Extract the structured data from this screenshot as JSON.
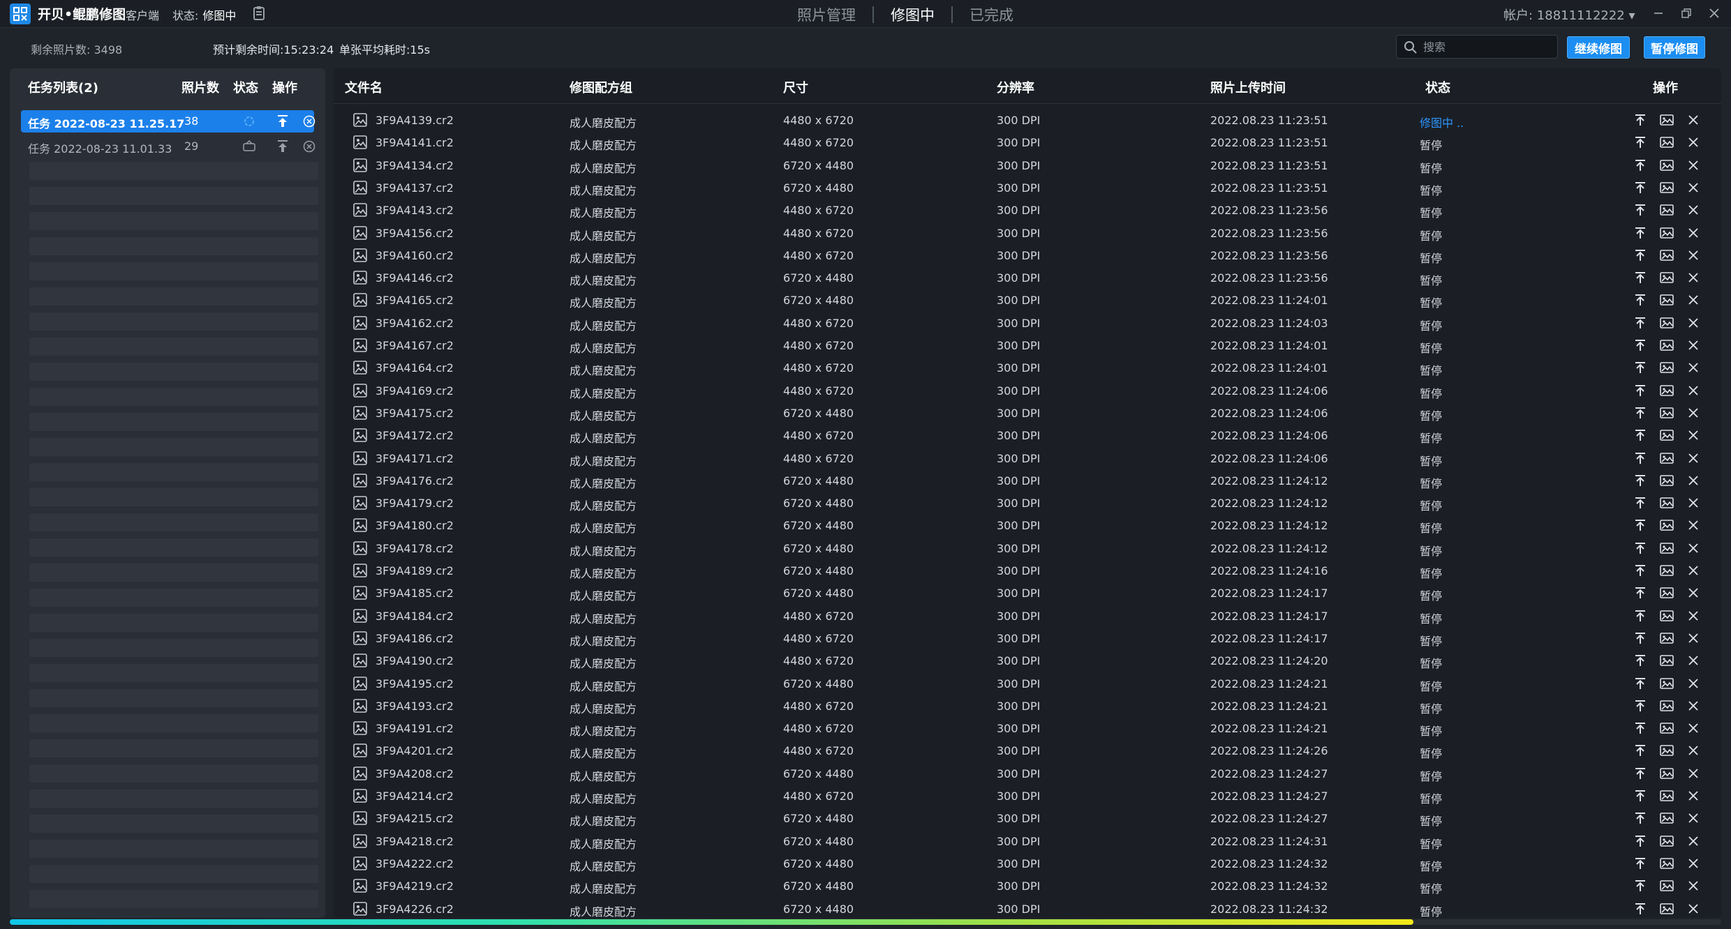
{
  "app": {
    "title": "开贝•鲲鹏修图",
    "subtitle": "客户端",
    "status_label": "状态:",
    "status_value": "修图中"
  },
  "nav": {
    "tabs": [
      {
        "label": "照片管理",
        "active": false
      },
      {
        "label": "修图中",
        "active": true
      },
      {
        "label": "已完成",
        "active": false
      }
    ]
  },
  "account": {
    "label": "帐户: 18811112222"
  },
  "info": {
    "remaining_label": "剩余照片数:",
    "remaining_value": "3498",
    "eta": "预计剩余时间:15:23:24",
    "avg": "单张平均耗时:15s"
  },
  "search": {
    "placeholder": "搜索",
    "value": ""
  },
  "buttons": {
    "resume": "继续修图",
    "pause": "暂停修图"
  },
  "task_list": {
    "header": {
      "title": "任务列表(2)",
      "count": "照片数",
      "state": "状态",
      "ops": "操作"
    },
    "tasks": [
      {
        "name": "任务 2022-08-23 11.25.17",
        "count": "38",
        "selected": true
      },
      {
        "name": "任务 2022-08-23 11.01.33",
        "count": "29",
        "selected": false
      }
    ]
  },
  "table": {
    "headers": {
      "file": "文件名",
      "recipe": "修图配方组",
      "size": "尺寸",
      "res": "分辨率",
      "time": "照片上传时间",
      "status": "状态",
      "ops": "操作"
    },
    "rows": [
      [
        "3F9A4139.cr2",
        "成人磨皮配方",
        "4480 x 6720",
        "300 DPI",
        "2022.08.23 11:23:51",
        "修图中 .."
      ],
      [
        "3F9A4141.cr2",
        "成人磨皮配方",
        "4480 x 6720",
        "300 DPI",
        "2022.08.23 11:23:51",
        "暂停"
      ],
      [
        "3F9A4134.cr2",
        "成人磨皮配方",
        "6720 x 4480",
        "300 DPI",
        "2022.08.23 11:23:51",
        "暂停"
      ],
      [
        "3F9A4137.cr2",
        "成人磨皮配方",
        "6720 x 4480",
        "300 DPI",
        "2022.08.23 11:23:51",
        "暂停"
      ],
      [
        "3F9A4143.cr2",
        "成人磨皮配方",
        "4480 x 6720",
        "300 DPI",
        "2022.08.23 11:23:56",
        "暂停"
      ],
      [
        "3F9A4156.cr2",
        "成人磨皮配方",
        "4480 x 6720",
        "300 DPI",
        "2022.08.23 11:23:56",
        "暂停"
      ],
      [
        "3F9A4160.cr2",
        "成人磨皮配方",
        "4480 x 6720",
        "300 DPI",
        "2022.08.23 11:23:56",
        "暂停"
      ],
      [
        "3F9A4146.cr2",
        "成人磨皮配方",
        "6720 x 4480",
        "300 DPI",
        "2022.08.23 11:23:56",
        "暂停"
      ],
      [
        "3F9A4165.cr2",
        "成人磨皮配方",
        "6720 x 4480",
        "300 DPI",
        "2022.08.23 11:24:01",
        "暂停"
      ],
      [
        "3F9A4162.cr2",
        "成人磨皮配方",
        "4480 x 6720",
        "300 DPI",
        "2022.08.23 11:24:03",
        "暂停"
      ],
      [
        "3F9A4167.cr2",
        "成人磨皮配方",
        "4480 x 6720",
        "300 DPI",
        "2022.08.23 11:24:01",
        "暂停"
      ],
      [
        "3F9A4164.cr2",
        "成人磨皮配方",
        "4480 x 6720",
        "300 DPI",
        "2022.08.23 11:24:01",
        "暂停"
      ],
      [
        "3F9A4169.cr2",
        "成人磨皮配方",
        "4480 x 6720",
        "300 DPI",
        "2022.08.23 11:24:06",
        "暂停"
      ],
      [
        "3F9A4175.cr2",
        "成人磨皮配方",
        "6720 x 4480",
        "300 DPI",
        "2022.08.23 11:24:06",
        "暂停"
      ],
      [
        "3F9A4172.cr2",
        "成人磨皮配方",
        "4480 x 6720",
        "300 DPI",
        "2022.08.23 11:24:06",
        "暂停"
      ],
      [
        "3F9A4171.cr2",
        "成人磨皮配方",
        "4480 x 6720",
        "300 DPI",
        "2022.08.23 11:24:06",
        "暂停"
      ],
      [
        "3F9A4176.cr2",
        "成人磨皮配方",
        "6720 x 4480",
        "300 DPI",
        "2022.08.23 11:24:12",
        "暂停"
      ],
      [
        "3F9A4179.cr2",
        "成人磨皮配方",
        "6720 x 4480",
        "300 DPI",
        "2022.08.23 11:24:12",
        "暂停"
      ],
      [
        "3F9A4180.cr2",
        "成人磨皮配方",
        "6720 x 4480",
        "300 DPI",
        "2022.08.23 11:24:12",
        "暂停"
      ],
      [
        "3F9A4178.cr2",
        "成人磨皮配方",
        "6720 x 4480",
        "300 DPI",
        "2022.08.23 11:24:12",
        "暂停"
      ],
      [
        "3F9A4189.cr2",
        "成人磨皮配方",
        "6720 x 4480",
        "300 DPI",
        "2022.08.23 11:24:16",
        "暂停"
      ],
      [
        "3F9A4185.cr2",
        "成人磨皮配方",
        "6720 x 4480",
        "300 DPI",
        "2022.08.23 11:24:17",
        "暂停"
      ],
      [
        "3F9A4184.cr2",
        "成人磨皮配方",
        "4480 x 6720",
        "300 DPI",
        "2022.08.23 11:24:17",
        "暂停"
      ],
      [
        "3F9A4186.cr2",
        "成人磨皮配方",
        "4480 x 6720",
        "300 DPI",
        "2022.08.23 11:24:17",
        "暂停"
      ],
      [
        "3F9A4190.cr2",
        "成人磨皮配方",
        "4480 x 6720",
        "300 DPI",
        "2022.08.23 11:24:20",
        "暂停"
      ],
      [
        "3F9A4195.cr2",
        "成人磨皮配方",
        "6720 x 4480",
        "300 DPI",
        "2022.08.23 11:24:21",
        "暂停"
      ],
      [
        "3F9A4193.cr2",
        "成人磨皮配方",
        "4480 x 6720",
        "300 DPI",
        "2022.08.23 11:24:21",
        "暂停"
      ],
      [
        "3F9A4191.cr2",
        "成人磨皮配方",
        "4480 x 6720",
        "300 DPI",
        "2022.08.23 11:24:21",
        "暂停"
      ],
      [
        "3F9A4201.cr2",
        "成人磨皮配方",
        "4480 x 6720",
        "300 DPI",
        "2022.08.23 11:24:26",
        "暂停"
      ],
      [
        "3F9A4208.cr2",
        "成人磨皮配方",
        "6720 x 4480",
        "300 DPI",
        "2022.08.23 11:24:27",
        "暂停"
      ],
      [
        "3F9A4214.cr2",
        "成人磨皮配方",
        "4480 x 6720",
        "300 DPI",
        "2022.08.23 11:24:27",
        "暂停"
      ],
      [
        "3F9A4215.cr2",
        "成人磨皮配方",
        "6720 x 4480",
        "300 DPI",
        "2022.08.23 11:24:27",
        "暂停"
      ],
      [
        "3F9A4218.cr2",
        "成人磨皮配方",
        "6720 x 4480",
        "300 DPI",
        "2022.08.23 11:24:31",
        "暂停"
      ],
      [
        "3F9A4222.cr2",
        "成人磨皮配方",
        "6720 x 4480",
        "300 DPI",
        "2022.08.23 11:24:32",
        "暂停"
      ],
      [
        "3F9A4219.cr2",
        "成人磨皮配方",
        "6720 x 4480",
        "300 DPI",
        "2022.08.23 11:24:32",
        "暂停"
      ],
      [
        "3F9A4226.cr2",
        "成人磨皮配方",
        "6720 x 4480",
        "300 DPI",
        "2022.08.23 11:24:32",
        "暂停"
      ]
    ]
  },
  "progress": {
    "fraction": 0.82
  },
  "colors": {
    "accent": "#1c8ef2",
    "status_active": "#2d96ff",
    "bg": "#1f232a",
    "panel": "#2a2f37"
  },
  "icons": {
    "logo": "app-logo-icon",
    "doc": "clipboard-icon",
    "search": "search-icon",
    "file": "image-file-icon",
    "top": "move-to-top-icon",
    "preview": "picture-icon",
    "delete": "close-icon"
  }
}
